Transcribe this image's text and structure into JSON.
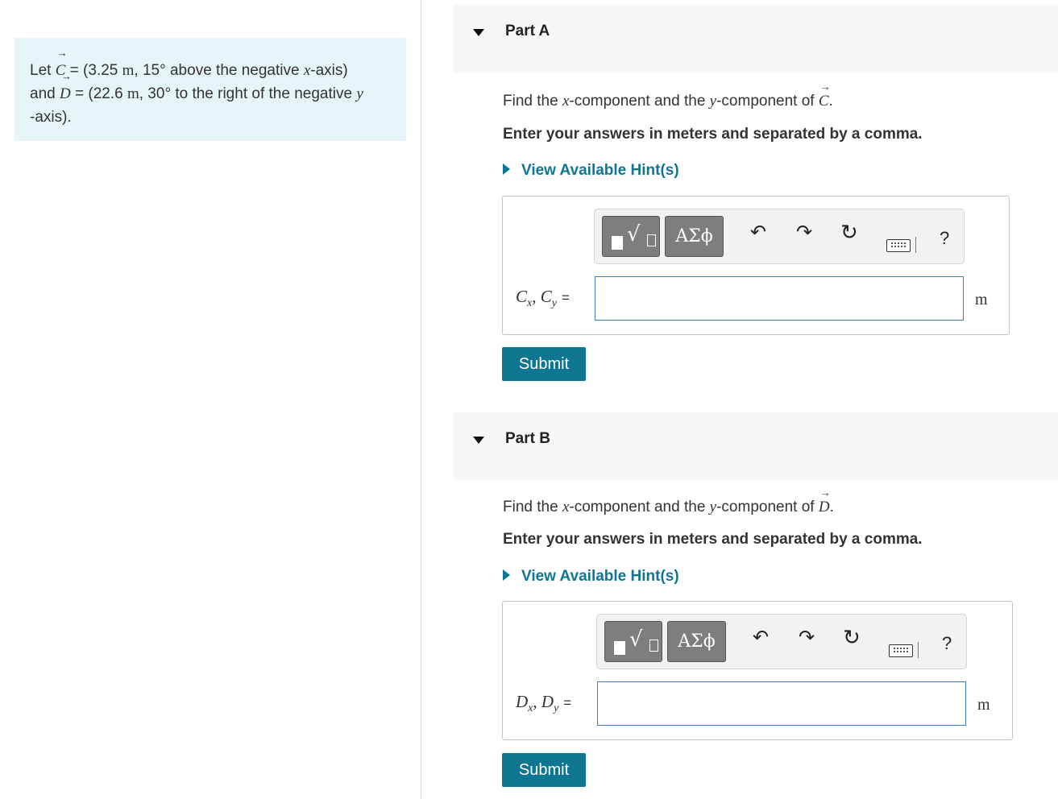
{
  "problem": {
    "let": "Let",
    "c_symbol": "C",
    "c_eq": " = (3.25 ",
    "c_unit": "m",
    "c_rest": ", 15° above the negative ",
    "c_axis": "x",
    "c_end": "-axis)",
    "and": "and",
    "d_symbol": "D",
    "d_eq": " = (22.6 ",
    "d_unit": "m",
    "d_rest": ", 30° to the right of the negative ",
    "d_axis": "y",
    "d_end": "-axis)."
  },
  "toolbar": {
    "templates_icon": "radical-templates-icon",
    "greek_label": "ΑΣϕ",
    "undo_icon": "undo-icon",
    "redo_icon": "redo-icon",
    "reset_icon": "reset-icon",
    "keyboard_icon": "keyboard-icon",
    "help_label": "?"
  },
  "parts": [
    {
      "title": "Part A",
      "prompt_pre": "Find the ",
      "prompt_x": "x",
      "prompt_mid": "-component and the ",
      "prompt_y": "y",
      "prompt_post": "-component of ",
      "prompt_vec": "C",
      "prompt_end": ".",
      "instruction": "Enter your answers in meters and separated by a comma.",
      "hint_label": "View Available Hint(s)",
      "label_a": "C",
      "label_a_sub": "x",
      "label_b": "C",
      "label_b_sub": "y",
      "label_eq": "=",
      "input_value": "",
      "unit": "m",
      "submit_label": "Submit"
    },
    {
      "title": "Part B",
      "prompt_pre": "Find the ",
      "prompt_x": "x",
      "prompt_mid": "-component and the ",
      "prompt_y": "y",
      "prompt_post": "-component of ",
      "prompt_vec": "D",
      "prompt_end": ".",
      "instruction": "Enter your answers in meters and separated by a comma.",
      "hint_label": "View Available Hint(s)",
      "label_a": "D",
      "label_a_sub": "x",
      "label_b": "D",
      "label_b_sub": "y",
      "label_eq": "=",
      "input_value": "",
      "unit": "m",
      "submit_label": "Submit"
    }
  ],
  "colors": {
    "accent": "#0e7691",
    "problem_bg": "#e6f5f7",
    "header_bg": "#f7f7f7",
    "input_border": "#3a7ebf"
  }
}
